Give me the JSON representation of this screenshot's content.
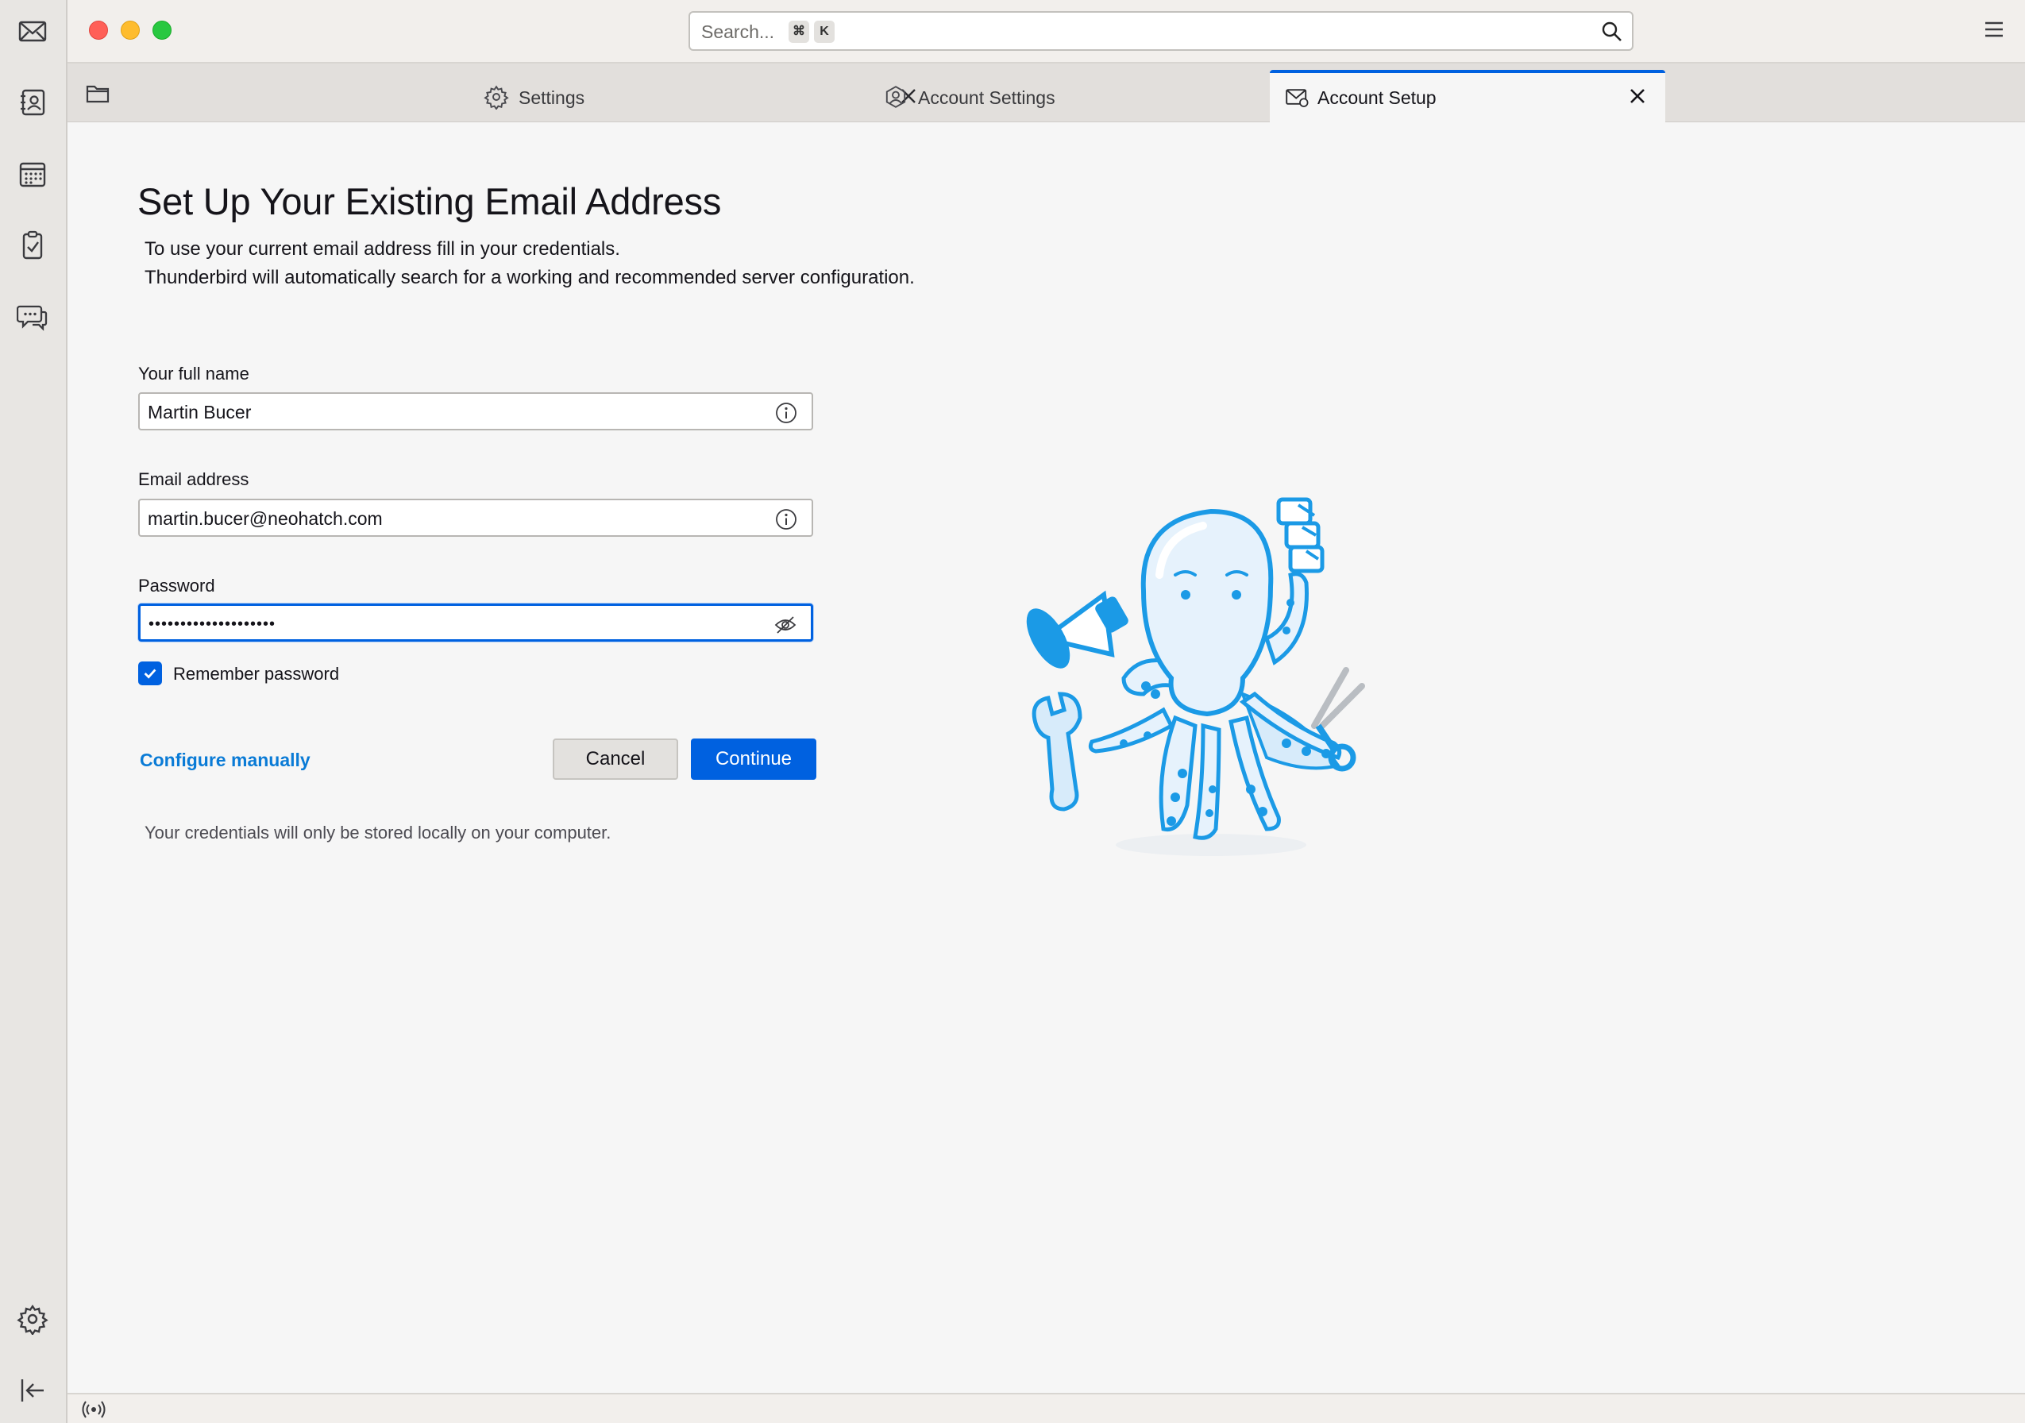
{
  "window": {
    "search": {
      "placeholder": "Search...",
      "shortcut_keys": [
        "⌘",
        "K"
      ]
    }
  },
  "spaces": [
    {
      "name": "mail",
      "icon": "mail-icon"
    },
    {
      "name": "address-book",
      "icon": "address-book-icon"
    },
    {
      "name": "calendar",
      "icon": "calendar-icon"
    },
    {
      "name": "tasks",
      "icon": "tasks-icon"
    },
    {
      "name": "chat",
      "icon": "chat-icon"
    },
    {
      "name": "settings",
      "icon": "gear-icon"
    },
    {
      "name": "collapse",
      "icon": "collapse-icon"
    }
  ],
  "tabs": [
    {
      "label": "Settings",
      "icon": "gear-icon",
      "active": false
    },
    {
      "label": "Account Settings",
      "icon": "account-icon",
      "active": false
    },
    {
      "label": "Account Setup",
      "icon": "mail-setup-icon",
      "active": true
    }
  ],
  "form": {
    "title": "Set Up Your Existing Email Address",
    "intro_line1": "To use your current email address fill in your credentials.",
    "intro_line2": "Thunderbird will automatically search for a working and recommended server configuration.",
    "full_name": {
      "label": "Your full name",
      "value": "Martin Bucer"
    },
    "email": {
      "label": "Email address",
      "value": "martin.bucer@neohatch.com"
    },
    "password": {
      "label": "Password",
      "value": "••••••••••••••••••••"
    },
    "remember_password": {
      "label": "Remember password",
      "checked": true
    },
    "configure_manually": "Configure manually",
    "cancel": "Cancel",
    "continue": "Continue",
    "note": "Your credentials will only be stored locally on your computer."
  },
  "colors": {
    "accent": "#0061e0",
    "link": "#0a7bd6",
    "illustration_blue": "#1b9ae6",
    "illustration_light": "#d7ebfa"
  }
}
